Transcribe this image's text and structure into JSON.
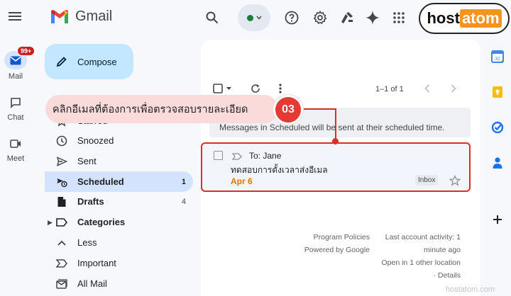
{
  "app": {
    "name": "Gmail"
  },
  "rail": {
    "mail_label": "Mail",
    "mail_badge": "99+",
    "chat_label": "Chat",
    "meet_label": "Meet"
  },
  "brand": {
    "part1": "host",
    "part2": "atom",
    "watermark": "hostatom.com"
  },
  "compose_label": "Compose",
  "nav": {
    "starred": "Starred",
    "snoozed": "Snoozed",
    "sent": "Sent",
    "scheduled": "Scheduled",
    "scheduled_count": "1",
    "drafts": "Drafts",
    "drafts_count": "4",
    "categories": "Categories",
    "less": "Less",
    "important": "Important",
    "all_mail": "All Mail"
  },
  "toolbar": {
    "pager": "1–1 of 1"
  },
  "info": {
    "text": "Messages in Scheduled will be sent at their scheduled time."
  },
  "email": {
    "to": "To: Jane",
    "subject": "ทดสอบการตั้งเวลาส่งอีเมล",
    "date": "Apr 6",
    "label": "Inbox"
  },
  "footer": {
    "policies": "Program Policies",
    "powered": "Powered by Google",
    "activity1": "Last account activity: 1",
    "activity2": "minute ago",
    "activity3": "Open in 1 other location",
    "activity4": "· Details"
  },
  "annotation": {
    "text": "คลิกอีเมลที่ต้องการเพื่อตรวจสอบรายละเอียด",
    "step": "03"
  },
  "colors": {
    "accent": "#d93025",
    "date": "#e37400",
    "compose_bg": "#c2e7ff",
    "active_bg": "#d3e3fd"
  }
}
